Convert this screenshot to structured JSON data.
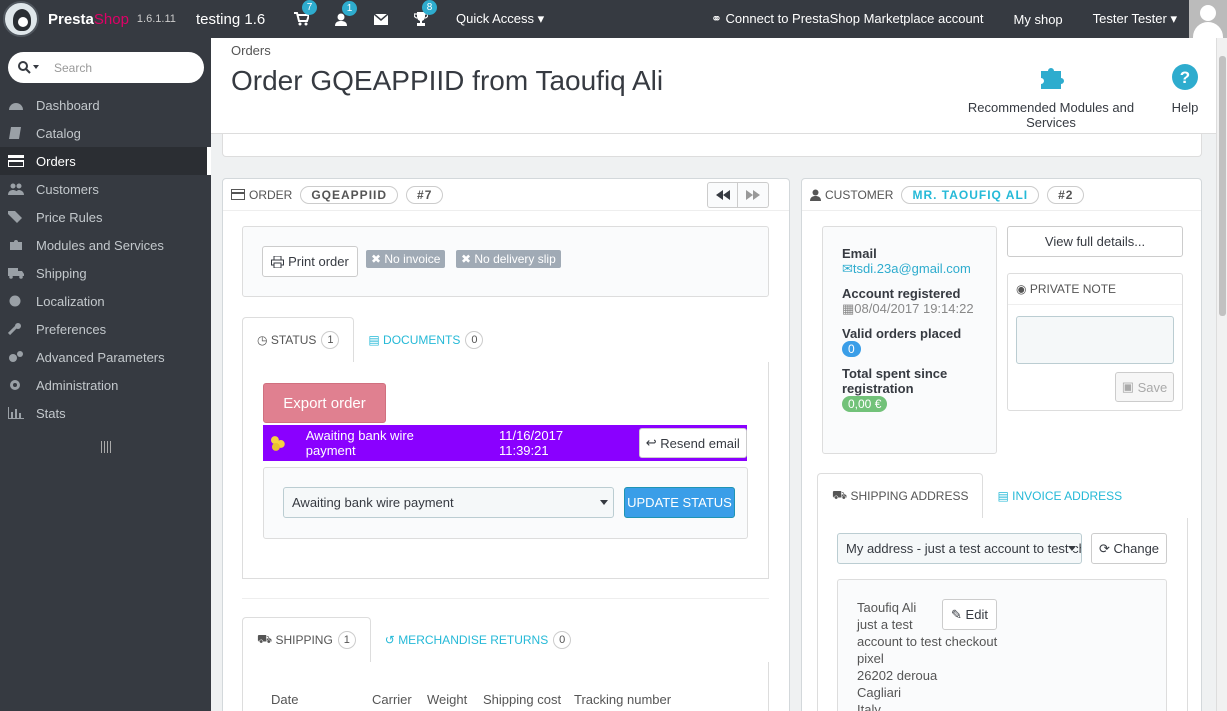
{
  "topbar": {
    "logo_a": "Presta",
    "logo_b": "Shop",
    "version": "1.6.1.11",
    "shop_name": "testing 1.6",
    "badges": {
      "orders": "7",
      "customers": "1",
      "messages": "",
      "trophy": "8"
    },
    "quick_access": "Quick Access",
    "connect": "Connect to PrestaShop Marketplace account",
    "my_shop": "My shop",
    "user": "Tester Tester"
  },
  "sidebar": {
    "search_placeholder": "Search",
    "items": [
      {
        "label": "Dashboard"
      },
      {
        "label": "Catalog"
      },
      {
        "label": "Orders"
      },
      {
        "label": "Customers"
      },
      {
        "label": "Price Rules"
      },
      {
        "label": "Modules and Services"
      },
      {
        "label": "Shipping"
      },
      {
        "label": "Localization"
      },
      {
        "label": "Preferences"
      },
      {
        "label": "Advanced Parameters"
      },
      {
        "label": "Administration"
      },
      {
        "label": "Stats"
      }
    ]
  },
  "header": {
    "breadcrumb": "Orders",
    "title": "Order GQEAPPIID from Taoufiq Ali",
    "recommended": "Recommended Modules and Services",
    "help": "Help"
  },
  "order": {
    "heading": "ORDER",
    "reference": "GQEAPPIID",
    "id": "#7",
    "print_order": "Print order",
    "no_invoice": "No invoice",
    "no_delivery": "No delivery slip",
    "tab_status": "STATUS",
    "tab_status_count": "1",
    "tab_documents": "DOCUMENTS",
    "tab_documents_count": "0",
    "export_order": "Export order",
    "status_text": "Awaiting bank wire payment",
    "status_date": "11/16/2017 11:39:21",
    "resend_email": "Resend email",
    "status_select": "Awaiting bank wire payment",
    "update_status": "UPDATE STATUS",
    "tab_shipping": "SHIPPING",
    "tab_shipping_count": "1",
    "tab_returns": "MERCHANDISE RETURNS",
    "tab_returns_count": "0",
    "shipping_cols": [
      "Date",
      "Carrier",
      "Weight",
      "Shipping cost",
      "Tracking number"
    ]
  },
  "customer": {
    "heading": "CUSTOMER",
    "name": "MR. TAOUFIQ ALI",
    "id": "#2",
    "email_label": "Email",
    "email": "tsdi.23a@gmail.com",
    "registered_label": "Account registered",
    "registered": "08/04/2017 19:14:22",
    "valid_orders_label": "Valid orders placed",
    "valid_orders": "0",
    "total_spent_label": "Total spent since registration",
    "total_spent": "0,00 €",
    "view_details": "View full details...",
    "private_note": "PRIVATE NOTE",
    "save": "Save",
    "tab_shipping_addr": "SHIPPING ADDRESS",
    "tab_invoice_addr": "INVOICE ADDRESS",
    "address_select": "My address - just a test account to test checkout",
    "change": "Change",
    "edit": "Edit",
    "address_lines": [
      "Taoufiq Ali",
      "just a test",
      "account to test checkout",
      "pixel",
      "26202 deroua",
      "Cagliari",
      "Italy"
    ]
  }
}
